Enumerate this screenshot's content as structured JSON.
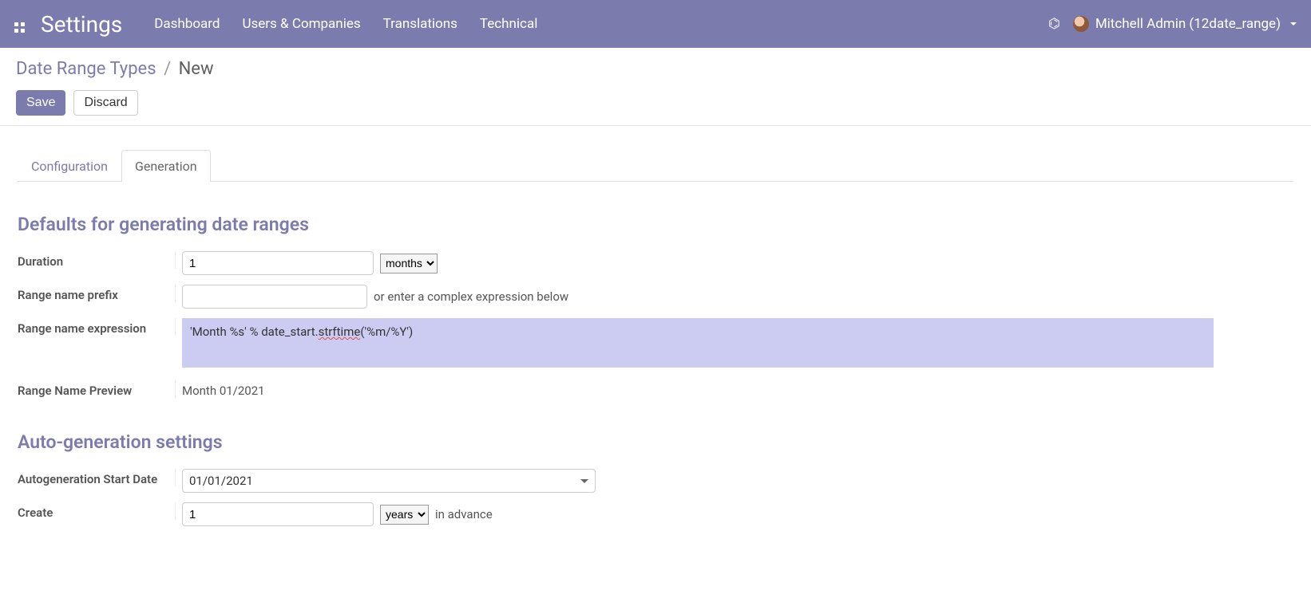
{
  "navbar": {
    "brand": "Settings",
    "menu": [
      "Dashboard",
      "Users & Companies",
      "Translations",
      "Technical"
    ],
    "user": "Mitchell Admin (12date_range)"
  },
  "breadcrumb": {
    "parent": "Date Range Types",
    "current": "New"
  },
  "buttons": {
    "save": "Save",
    "discard": "Discard"
  },
  "tabs": {
    "configuration": "Configuration",
    "generation": "Generation"
  },
  "section1": {
    "title": "Defaults for generating date ranges",
    "duration_label": "Duration",
    "duration_value": "1",
    "duration_unit": "months",
    "prefix_label": "Range name prefix",
    "prefix_value": "",
    "prefix_helper": "or enter a complex expression below",
    "expr_label": "Range name expression",
    "expr_value": "'Month %s' % date_start.strftime('%m/%Y')",
    "expr_pre": "'Month %s' % date_start.",
    "expr_squiggle": "strftime",
    "expr_post": "('%m/%Y')",
    "preview_label": "Range Name Preview",
    "preview_value": "Month 01/2021"
  },
  "section2": {
    "title": "Auto-generation settings",
    "startdate_label": "Autogeneration Start Date",
    "startdate_value": "01/01/2021",
    "create_label": "Create",
    "create_value": "1",
    "create_unit": "years",
    "create_suffix": "in advance"
  }
}
